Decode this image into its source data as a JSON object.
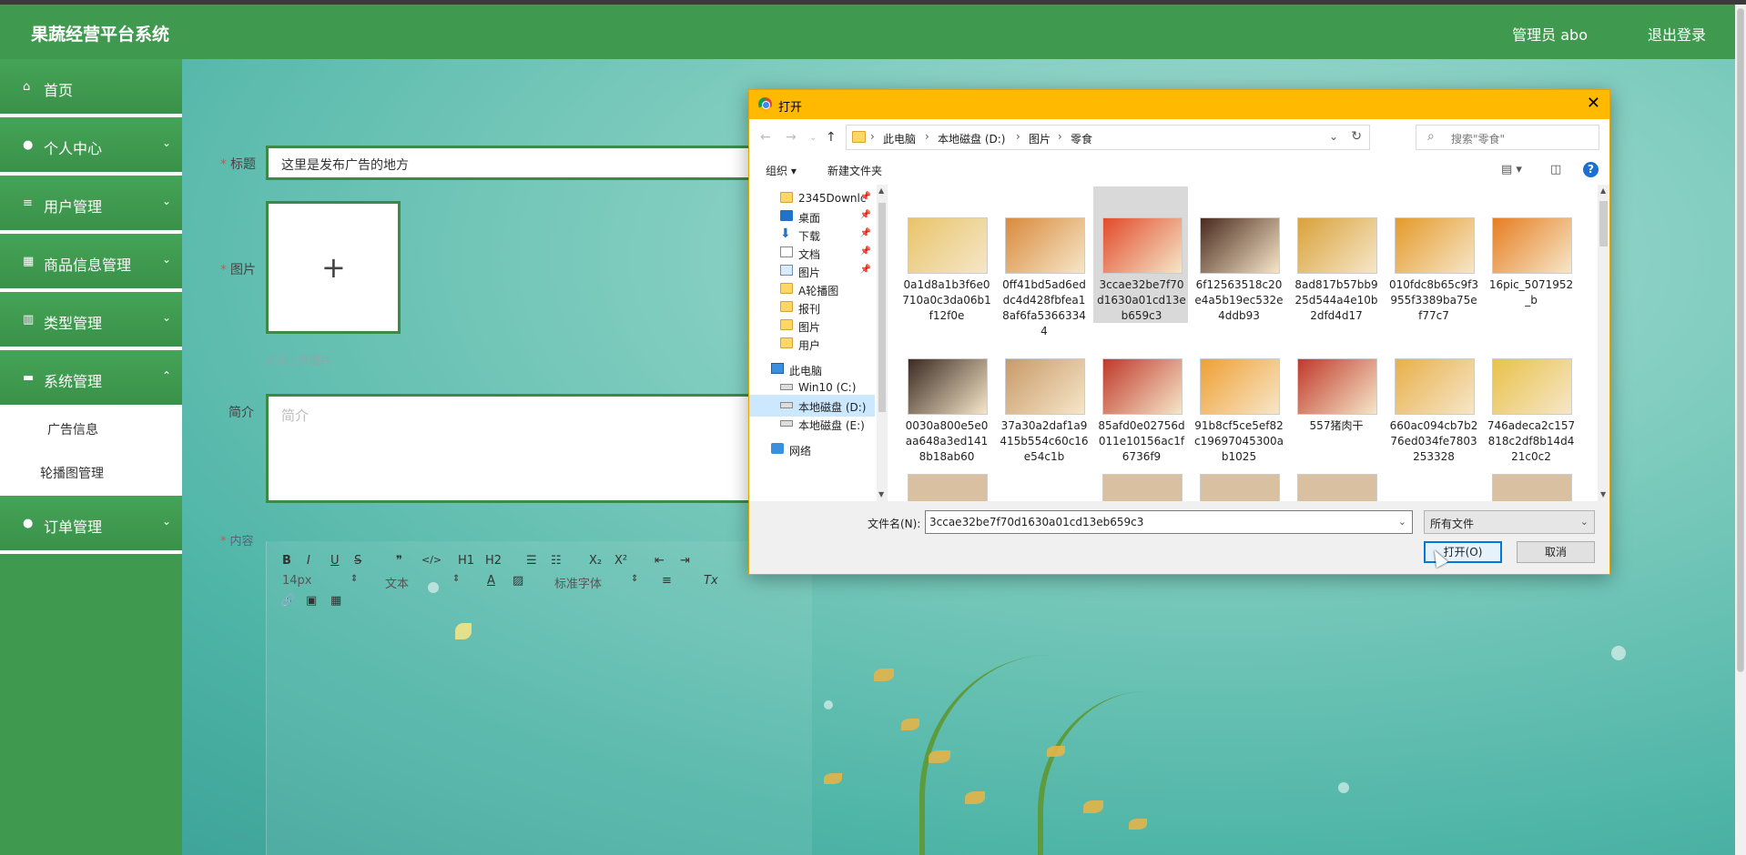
{
  "app": {
    "brand": "果蔬经营平台系统",
    "user": "管理员 abo",
    "logout": "退出登录"
  },
  "sidebar": {
    "items": [
      {
        "label": "首页",
        "icon": "home-icon"
      },
      {
        "label": "个人中心",
        "icon": "user-icon"
      },
      {
        "label": "用户管理",
        "icon": "menu-icon"
      },
      {
        "label": "商品信息管理",
        "icon": "grid-icon"
      },
      {
        "label": "类型管理",
        "icon": "bar-chart-icon"
      },
      {
        "label": "系统管理",
        "icon": "list-icon"
      }
    ],
    "sub_items": [
      "广告信息",
      "轮播图管理"
    ],
    "last_item": {
      "label": "订单管理",
      "icon": "location-icon"
    }
  },
  "form": {
    "title_label": "标题",
    "title_value": "这里是发布广告的地方",
    "image_label": "图片",
    "upload_hint": "点击上传图片",
    "intro_label": "简介",
    "intro_placeholder": "简介",
    "content_label": "内容",
    "editor": {
      "font_size": "14px",
      "text_style": "文本",
      "font_family": "标准字体",
      "row1": [
        "B",
        "I",
        "U",
        "S",
        "❞",
        "</>",
        "H1",
        "H2",
        "☰",
        "☷",
        "X₂",
        "X²",
        "⇤",
        "⇥"
      ],
      "row2_marks": [
        "A",
        "▨",
        "≡",
        "Tx"
      ],
      "row3": [
        "🔗",
        "▣",
        "▦"
      ]
    }
  },
  "dialog": {
    "title": "打开",
    "breadcrumbs": [
      "此电脑",
      "本地磁盘 (D:)",
      "图片",
      "零食"
    ],
    "search_placeholder": "搜索\"零食\"",
    "organize": "组织 ▾",
    "new_folder": "新建文件夹",
    "tree": [
      {
        "label": "2345Downlc",
        "icon": "folder",
        "pin": true
      },
      {
        "label": "桌面",
        "icon": "desktop",
        "pin": true
      },
      {
        "label": "下载",
        "icon": "down",
        "pin": true
      },
      {
        "label": "文档",
        "icon": "doc",
        "pin": true
      },
      {
        "label": "图片",
        "icon": "pic",
        "pin": true
      },
      {
        "label": "A轮播图",
        "icon": "folder",
        "pin": false
      },
      {
        "label": "报刊",
        "icon": "folder",
        "pin": false
      },
      {
        "label": "图片",
        "icon": "folder",
        "pin": false
      },
      {
        "label": "用户",
        "icon": "folder",
        "pin": false
      },
      {
        "label": "此电脑",
        "icon": "pc",
        "pin": false
      },
      {
        "label": "Win10 (C:)",
        "icon": "drive",
        "pin": false
      },
      {
        "label": "本地磁盘 (D:)",
        "icon": "drive",
        "pin": false,
        "selected": true
      },
      {
        "label": "本地磁盘 (E:)",
        "icon": "drive",
        "pin": false
      },
      {
        "label": "网络",
        "icon": "net",
        "pin": false
      }
    ],
    "files": [
      {
        "name": "0a1d8a1b3f6e0710a0c3da06b1f12f0e",
        "color": "#e8c46a"
      },
      {
        "name": "0ff41bd5ad6eddc4d428fbfea18af6fa53663344",
        "color": "#d98a3c"
      },
      {
        "name": "3ccae32be7f70d1630a01cd13eb659c3",
        "color": "#e24a2b",
        "selected": true
      },
      {
        "name": "6f12563518c20e4a5b19ec532e4ddb93",
        "color": "#4a2a1e"
      },
      {
        "name": "8ad817b57bb925d544a4e10b2dfd4d17",
        "color": "#d9a23a"
      },
      {
        "name": "010fdc8b65c9f3955f3389ba75ef77c7",
        "color": "#e59a2a"
      },
      {
        "name": "16pic_5071952_b",
        "color": "#e67e22"
      },
      {
        "name": "0030a800e5e0aa648a3ed1418b18ab60",
        "color": "#3a2a22"
      },
      {
        "name": "37a30a2daf1a9415b554c60c16e54c1b",
        "color": "#c99a6a"
      },
      {
        "name": "85afd0e02756d011e10156ac1f6736f9",
        "color": "#c0392b"
      },
      {
        "name": "91b8cf5ce5ef82c19697045300ab1025",
        "color": "#f0a035"
      },
      {
        "name": "557猪肉干",
        "color": "#c0392b"
      },
      {
        "name": "660ac094cb7b276ed034fe7803253328",
        "color": "#e8b04a"
      },
      {
        "name": "746adeca2c157818c2df8b14d421c0c2",
        "color": "#e8c24a"
      }
    ],
    "filename_label": "文件名(N):",
    "filename_value": "3ccae32be7f70d1630a01cd13eb659c3",
    "filetype": "所有文件",
    "open_button": "打开(O)",
    "cancel_button": "取消"
  }
}
